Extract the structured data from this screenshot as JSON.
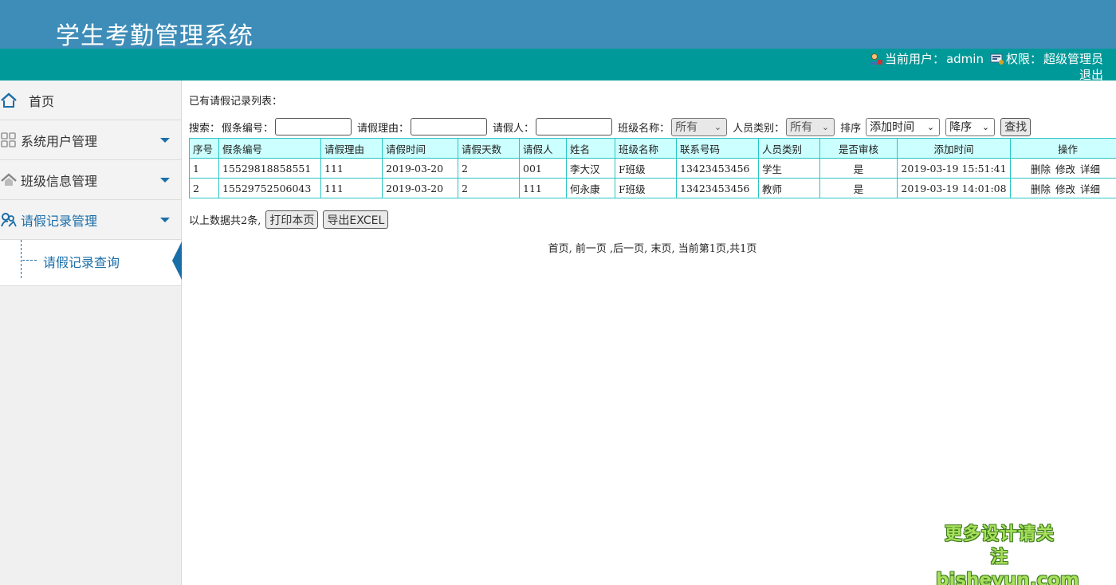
{
  "app": {
    "title": "学生考勤管理系统"
  },
  "header": {
    "current_user_label": "当前用户：",
    "current_user": "admin",
    "permission_label": "权限：",
    "permission": "超级管理员",
    "logout": "退出"
  },
  "sidebar": {
    "items": [
      {
        "label": "首页",
        "icon": "home-icon"
      },
      {
        "label": "系统用户管理",
        "icon": "grid-icon"
      },
      {
        "label": "班级信息管理",
        "icon": "house-icon"
      },
      {
        "label": "请假记录管理",
        "icon": "users-icon"
      }
    ],
    "sub_items": [
      {
        "label": "请假记录查询"
      }
    ]
  },
  "main": {
    "list_title": "已有请假记录列表：",
    "search": {
      "label": "搜索：",
      "no_label": "假条编号：",
      "reason_label": "请假理由：",
      "person_label": "请假人：",
      "class_label": "班级名称：",
      "class_value": "所有",
      "type_label": "人员类别：",
      "type_value": "所有",
      "sort_label": "排序",
      "sort_field": "添加时间",
      "sort_order": "降序",
      "find_button": "查找"
    },
    "table": {
      "headers": [
        "序号",
        "假条编号",
        "请假理由",
        "请假时间",
        "请假天数",
        "请假人",
        "姓名",
        "班级名称",
        "联系号码",
        "人员类别",
        "是否审核",
        "添加时间",
        "操作"
      ],
      "rows": [
        [
          "1",
          "15529818858551",
          "111",
          "2019-03-20",
          "2",
          "001",
          "李大汉",
          "F班级",
          "13423453456",
          "学生",
          "是",
          "2019-03-19 15:51:41"
        ],
        [
          "2",
          "15529752506043",
          "111",
          "2019-03-20",
          "2",
          "111",
          "何永康",
          "F班级",
          "13423453456",
          "教师",
          "是",
          "2019-03-19 14:01:08"
        ]
      ],
      "actions": [
        "删除",
        "修改",
        "详细"
      ]
    },
    "summary": "以上数据共2条,",
    "print_button": "打印本页",
    "export_button": "导出EXCEL",
    "pager": {
      "first": "首页,",
      "prev": "前一页",
      "next": ",后一页,",
      "last": "末页,",
      "info": "当前第1页,共1页"
    }
  },
  "watermark": {
    "line1": "更多设计请关注",
    "line2": "bisheyun.com"
  }
}
